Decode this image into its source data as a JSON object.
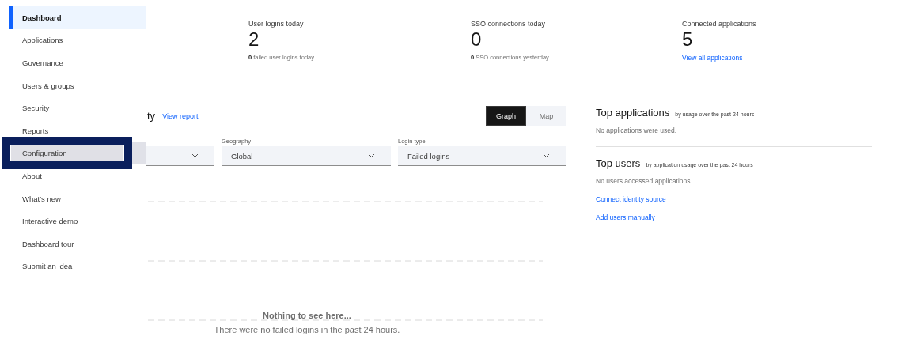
{
  "sidebar": {
    "items": [
      {
        "label": "Dashboard",
        "selected": true,
        "focused": false
      },
      {
        "label": "Applications",
        "selected": false,
        "focused": false
      },
      {
        "label": "Governance",
        "selected": false,
        "focused": false
      },
      {
        "label": "Users & groups",
        "selected": false,
        "focused": false
      },
      {
        "label": "Security",
        "selected": false,
        "focused": false
      },
      {
        "label": "Reports",
        "selected": false,
        "focused": false
      },
      {
        "label": "Configuration",
        "selected": false,
        "focused": true
      },
      {
        "label": "About",
        "selected": false,
        "focused": false
      },
      {
        "label": "What's new",
        "selected": false,
        "focused": false
      },
      {
        "label": "Interactive demo",
        "selected": false,
        "focused": false
      },
      {
        "label": "Dashboard tour",
        "selected": false,
        "focused": false
      },
      {
        "label": "Submit an idea",
        "selected": false,
        "focused": false
      }
    ]
  },
  "stats": [
    {
      "kind": "note",
      "label": "User logins today",
      "value": "2",
      "note": "**0** failed user logins today"
    },
    {
      "kind": "note",
      "label": "SSO connections today",
      "value": "0",
      "note": "**0** SSO connections yesterday"
    },
    {
      "kind": "link",
      "label": "Connected applications",
      "value": "5",
      "link": "View all applications"
    }
  ],
  "activity": {
    "title": "ty",
    "link": "View report",
    "view_toggle": [
      {
        "label": "Graph",
        "selected": true
      },
      {
        "label": "Map",
        "selected": false
      }
    ],
    "filters": [
      {
        "kind": "dropdown"
      },
      {
        "kind": "dropdown",
        "label": "Geography",
        "value": "Global"
      },
      {
        "kind": "dropdown",
        "label": "Login type",
        "value": "Failed logins"
      }
    ],
    "empty_state": {
      "title": "Nothing to see here...",
      "message": "There were no failed logins in the past 24 hours."
    }
  },
  "top_applications": {
    "title": "Top applications",
    "subtitle": "by usage over the past 24 hours",
    "message": "No applications were used."
  },
  "top_users": {
    "title": "Top users",
    "subtitle": "by application usage over the past 24 hours",
    "message": "No users accessed applications.",
    "links": [
      "Connect identity source",
      "Add users manually"
    ]
  }
}
